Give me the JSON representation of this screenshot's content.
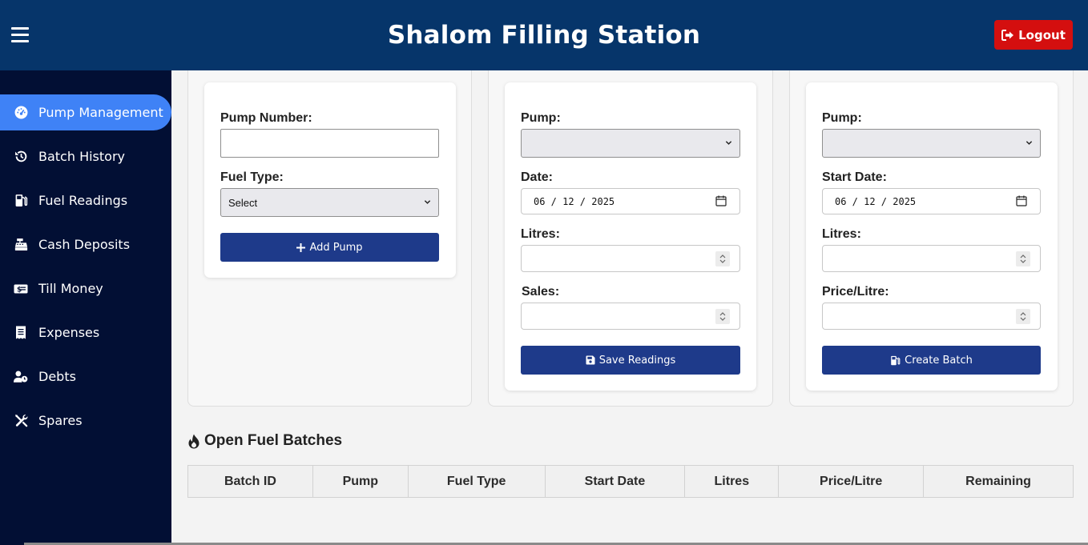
{
  "header": {
    "title": "Shalom Filling Station",
    "logout_label": "Logout",
    "colors": {
      "header_bg": "#06356a",
      "logout_bg": "#d40f0f"
    }
  },
  "sidebar": {
    "colors": {
      "bg": "#020f34",
      "active": "#3f82f6"
    },
    "items": [
      {
        "label": "Pump Management",
        "icon": "dashboard-gauge-icon",
        "active": true
      },
      {
        "label": "Batch History",
        "icon": "history-icon",
        "active": false
      },
      {
        "label": "Fuel Readings",
        "icon": "gas-pump-icon",
        "active": false
      },
      {
        "label": "Cash Deposits",
        "icon": "cash-register-icon",
        "active": false
      },
      {
        "label": "Till Money",
        "icon": "money-bill-icon",
        "active": false
      },
      {
        "label": "Expenses",
        "icon": "receipt-icon",
        "active": false
      },
      {
        "label": "Debts",
        "icon": "user-clock-icon",
        "active": false
      },
      {
        "label": "Spares",
        "icon": "tools-icon",
        "active": false
      }
    ]
  },
  "add_pump_form": {
    "pump_number_label": "Pump Number:",
    "pump_number_value": "",
    "fuel_type_label": "Fuel Type:",
    "fuel_type_selected": "Select",
    "submit_label": "Add Pump"
  },
  "readings_form": {
    "pump_label": "Pump:",
    "pump_selected": "",
    "date_label": "Date:",
    "date_value": "06 / 12 / 2025",
    "litres_label": "Litres:",
    "litres_value": "",
    "sales_label": "Sales:",
    "sales_value": "",
    "submit_label": "Save Readings"
  },
  "batch_form": {
    "pump_label": "Pump:",
    "pump_selected": "",
    "start_date_label": "Start Date:",
    "start_date_value": "06 / 12 / 2025",
    "litres_label": "Litres:",
    "litres_value": "",
    "price_label": "Price/Litre:",
    "price_value": "",
    "submit_label": "Create Batch"
  },
  "open_batches": {
    "title": "Open Fuel Batches",
    "columns": [
      "Batch ID",
      "Pump",
      "Fuel Type",
      "Start Date",
      "Litres",
      "Price/Litre",
      "Remaining"
    ],
    "rows": []
  }
}
